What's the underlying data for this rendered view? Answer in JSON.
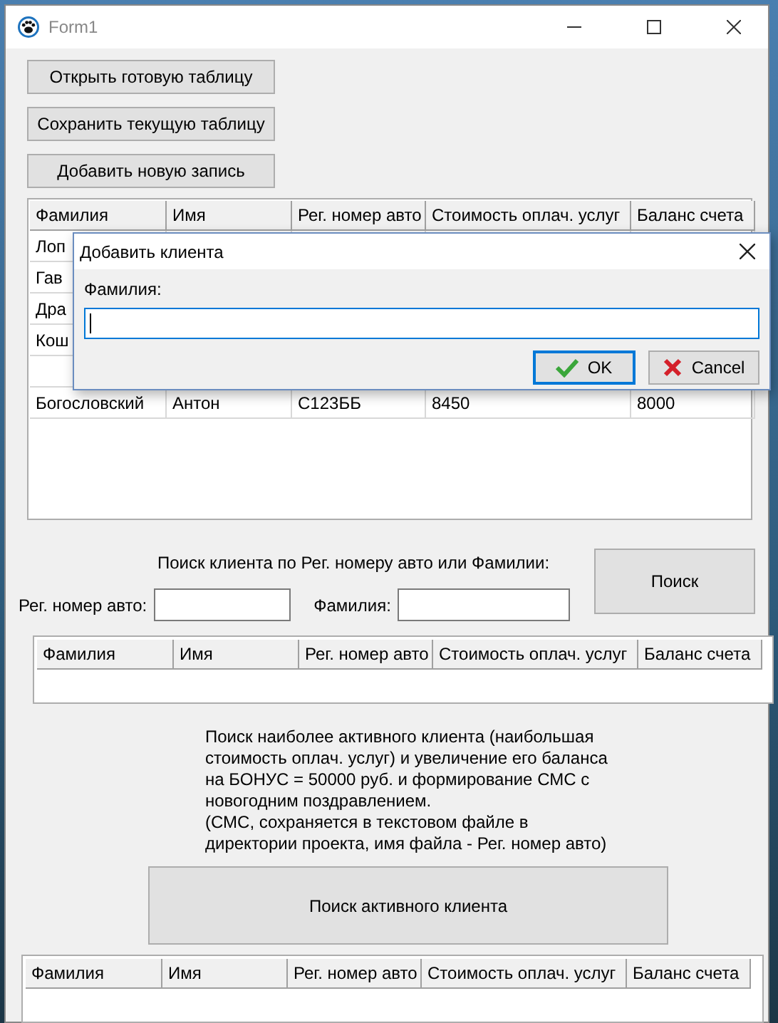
{
  "window": {
    "title": "Form1"
  },
  "toolbar_buttons": [
    "Открыть готовую таблицу",
    "Сохранить текущую таблицу",
    "Добавить новую запись"
  ],
  "table": {
    "columns": [
      "Фамилия",
      "Имя",
      "Рег. номер авто",
      "Стоимость оплач. услуг",
      "Баланс счета"
    ],
    "rows": [
      [
        "Лоп",
        "",
        "",
        "",
        ""
      ],
      [
        "Гав",
        "",
        "",
        "",
        ""
      ],
      [
        "Дра",
        "",
        "",
        "",
        ""
      ],
      [
        "Кош",
        "",
        "",
        "",
        ""
      ],
      [
        "",
        "",
        "",
        "",
        ""
      ],
      [
        "Богословский",
        "Антон",
        "С123ББ",
        "8450",
        "8000"
      ]
    ]
  },
  "dialog": {
    "title": "Добавить клиента",
    "field_label": "Фамилия:",
    "buttons": [
      {
        "label": "OK",
        "kind": "ok",
        "focused": true
      },
      {
        "label": "Cancel",
        "kind": "cancel",
        "focused": false
      }
    ]
  },
  "search": {
    "caption": "Поиск клиента по Рег. номеру авто или Фамилии:",
    "reg_label": "Рег. номер авто:",
    "surname_label": "Фамилия:",
    "button": "Поиск"
  },
  "search_results": {
    "columns": [
      "Фамилия",
      "Имя",
      "Рег. номер авто",
      "Стоимость оплач. услуг",
      "Баланс счета"
    ]
  },
  "active": {
    "description": "Поиск наиболее активного клиента (наибольшая\nстоимость оплач. услуг) и увеличение его баланса\nна БОНУС = 50000 руб. и формирование СМС с\nновогодним поздравлением.\n(СМС, сохраняется в текстовом файле в\nдиректории проекта, имя файла - Рег. номер авто)",
    "button": "Поиск активного клиента"
  },
  "active_results": {
    "columns": [
      "Фамилия",
      "Имя",
      "Рег. номер авто",
      "Стоимость оплач. услуг",
      "Баланс счета"
    ]
  }
}
